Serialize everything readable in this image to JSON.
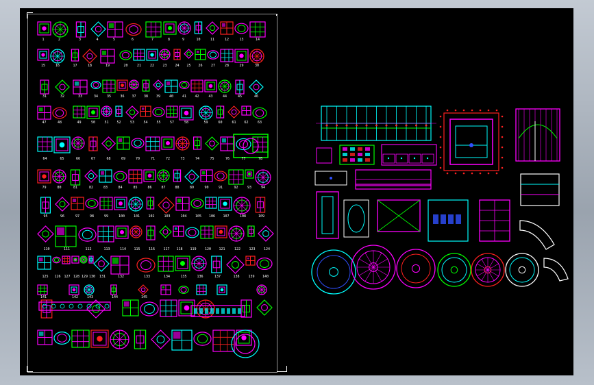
{
  "viewport": {
    "title": "",
    "background_color": "#000000",
    "colors": {
      "magenta": "#ff00ff",
      "green": "#00ff00",
      "cyan": "#00ffff",
      "red": "#ff2020",
      "white": "#ffffff",
      "blue": "#3050ff"
    }
  },
  "left_sheet": {
    "item_numbers": [
      "1",
      "2",
      "3",
      "4",
      "5",
      "6",
      "7",
      "8",
      "9",
      "10",
      "11",
      "12",
      "13",
      "14",
      "15",
      "16",
      "17",
      "18",
      "19",
      "20",
      "21",
      "22",
      "23",
      "24",
      "25",
      "26",
      "27",
      "28",
      "29",
      "30",
      "31",
      "32",
      "33",
      "34",
      "35",
      "36",
      "37",
      "38",
      "39",
      "40",
      "41",
      "42",
      "43",
      "44",
      "45",
      "46",
      "47",
      "48",
      "49",
      "50",
      "51",
      "52",
      "53",
      "54",
      "55",
      "57",
      "58",
      "59",
      "60",
      "61",
      "62",
      "63",
      "64",
      "65",
      "66",
      "67",
      "68",
      "69",
      "70",
      "71",
      "72",
      "73",
      "74",
      "75",
      "76",
      "77",
      "78",
      "79",
      "80",
      "81",
      "82",
      "83",
      "84",
      "85",
      "86",
      "87",
      "88",
      "89",
      "90",
      "91",
      "92",
      "93",
      "94",
      "95",
      "96",
      "97",
      "98",
      "99",
      "100",
      "101",
      "102",
      "103",
      "104",
      "105",
      "106",
      "107",
      "108",
      "109",
      "110",
      "111",
      "112",
      "113",
      "114",
      "115",
      "116",
      "117",
      "118",
      "119",
      "120",
      "121",
      "122",
      "123",
      "124",
      "125",
      "126",
      "127",
      "128",
      "129",
      "130",
      "131",
      "132",
      "133",
      "134",
      "135",
      "136",
      "137",
      "138",
      "139",
      "140",
      "141",
      "142",
      "143",
      "144",
      "145"
    ]
  },
  "right_sheet": {
    "components": [
      "beam-frame",
      "ceiling-panel",
      "curtain",
      "small-grid",
      "lighting-strip",
      "rail",
      "slab",
      "pillar",
      "tray",
      "cabinet",
      "ring-plates",
      "arc-detail"
    ]
  }
}
